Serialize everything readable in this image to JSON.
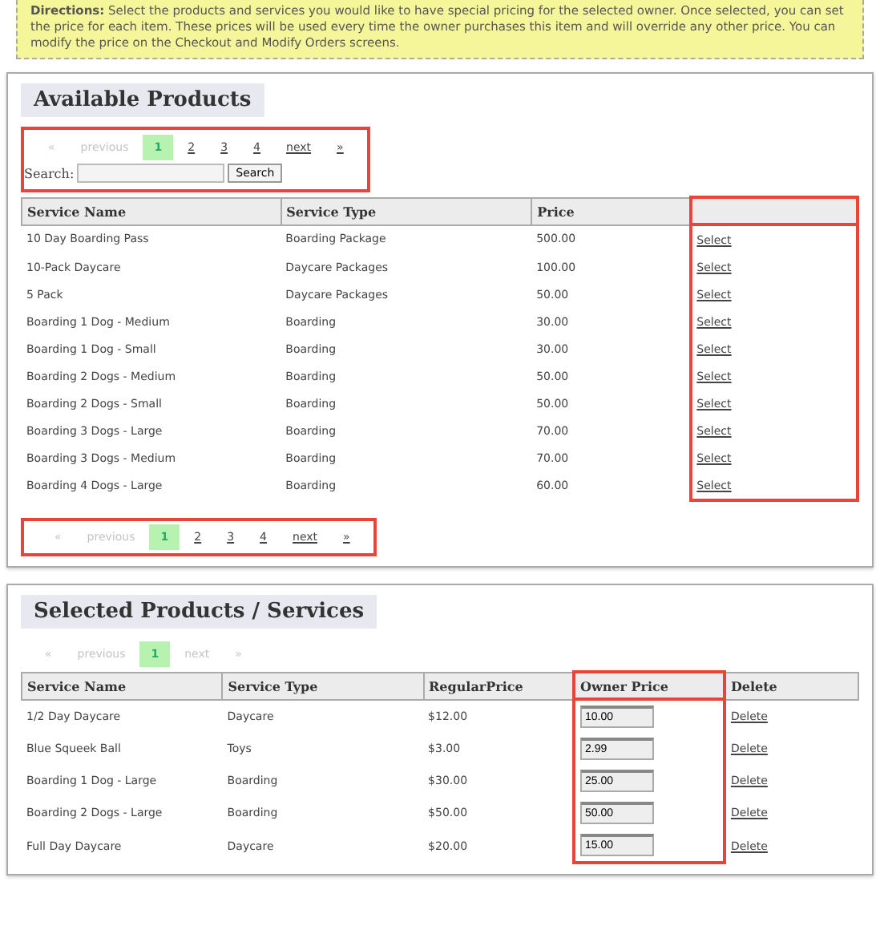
{
  "directions": {
    "label": "Directions:",
    "text": "Select the products and services you would like to have special pricing for the selected owner. Once selected, you can set the price for each item. These prices will be used every time the owner purchases this item and will override any other price. You can modify the price on the Checkout and Modify Orders screens."
  },
  "available": {
    "title": "Available Products",
    "top_controls": {
      "highlighted": true,
      "pager": [
        {
          "label": "«",
          "selected": false,
          "disabled": true
        },
        {
          "label": "previous",
          "selected": false,
          "disabled": true
        },
        {
          "label": "1",
          "selected": true,
          "disabled": false
        },
        {
          "label": "2",
          "selected": false,
          "disabled": false
        },
        {
          "label": "3",
          "selected": false,
          "disabled": false
        },
        {
          "label": "4",
          "selected": false,
          "disabled": false
        },
        {
          "label": "next",
          "selected": false,
          "disabled": false
        },
        {
          "label": "»",
          "selected": false,
          "disabled": false
        }
      ],
      "search": {
        "label": "Search:",
        "button": "Search"
      }
    },
    "columns": [
      {
        "label": "Service Name",
        "highlighted": false
      },
      {
        "label": "Service Type",
        "highlighted": false
      },
      {
        "label": "Price",
        "highlighted": false
      },
      {
        "highlighted": true
      }
    ],
    "rows": [
      [
        "10 Day Boarding Pass",
        "Boarding Package",
        "500.00",
        "Select"
      ],
      [
        "10-Pack Daycare",
        "Daycare Packages",
        "100.00",
        "Select"
      ],
      [
        "5 Pack",
        "Daycare Packages",
        "50.00",
        "Select"
      ],
      [
        "Boarding 1 Dog - Medium",
        "Boarding",
        "30.00",
        "Select"
      ],
      [
        "Boarding 1 Dog - Small",
        "Boarding",
        "30.00",
        "Select"
      ],
      [
        "Boarding 2 Dogs - Medium",
        "Boarding",
        "50.00",
        "Select"
      ],
      [
        "Boarding 2 Dogs - Small",
        "Boarding",
        "50.00",
        "Select"
      ],
      [
        "Boarding 3 Dogs - Large",
        "Boarding",
        "70.00",
        "Select"
      ],
      [
        "Boarding 3 Dogs - Medium",
        "Boarding",
        "70.00",
        "Select"
      ],
      [
        "Boarding 4 Dogs - Large",
        "Boarding",
        "60.00",
        "Select"
      ]
    ],
    "bottom_pager": {
      "highlighted": true,
      "pager": [
        {
          "label": "«",
          "selected": false,
          "disabled": true
        },
        {
          "label": "previous",
          "selected": false,
          "disabled": true
        },
        {
          "label": "1",
          "selected": true,
          "disabled": false
        },
        {
          "label": "2",
          "selected": false,
          "disabled": false
        },
        {
          "label": "3",
          "selected": false,
          "disabled": false
        },
        {
          "label": "4",
          "selected": false,
          "disabled": false
        },
        {
          "label": "next",
          "selected": false,
          "disabled": false
        },
        {
          "label": "»",
          "selected": false,
          "disabled": false
        }
      ]
    }
  },
  "selected": {
    "title": "Selected Products / Services",
    "pager": [
      {
        "label": "«",
        "selected": false,
        "disabled": true
      },
      {
        "label": "previous",
        "selected": false,
        "disabled": true
      },
      {
        "label": "1",
        "selected": true,
        "disabled": false
      },
      {
        "label": "next",
        "selected": false,
        "disabled": true
      },
      {
        "label": "»",
        "selected": false,
        "disabled": true
      }
    ],
    "columns": [
      {
        "label": "Service Name",
        "highlighted": false
      },
      {
        "label": "Service Type",
        "highlighted": false
      },
      {
        "label": "RegularPrice",
        "highlighted": false
      },
      {
        "label": "Owner Price",
        "highlighted": true
      },
      {
        "label": "Delete",
        "highlighted": false
      }
    ],
    "rows": [
      {
        "name": "1/2 Day Daycare",
        "type": "Daycare",
        "regular_price": "$12.00",
        "owner_price": "10.00",
        "action": "Delete"
      },
      {
        "name": "Blue Squeek Ball",
        "type": "Toys",
        "regular_price": "$3.00",
        "owner_price": "2.99",
        "action": "Delete"
      },
      {
        "name": "Boarding 1 Dog - Large",
        "type": "Boarding",
        "regular_price": "$30.00",
        "owner_price": "25.00",
        "action": "Delete"
      },
      {
        "name": "Boarding 2 Dogs - Large",
        "type": "Boarding",
        "regular_price": "$50.00",
        "owner_price": "50.00",
        "action": "Delete"
      },
      {
        "name": "Full Day Daycare",
        "type": "Daycare",
        "regular_price": "$20.00",
        "owner_price": "15.00",
        "action": "Delete"
      }
    ]
  }
}
